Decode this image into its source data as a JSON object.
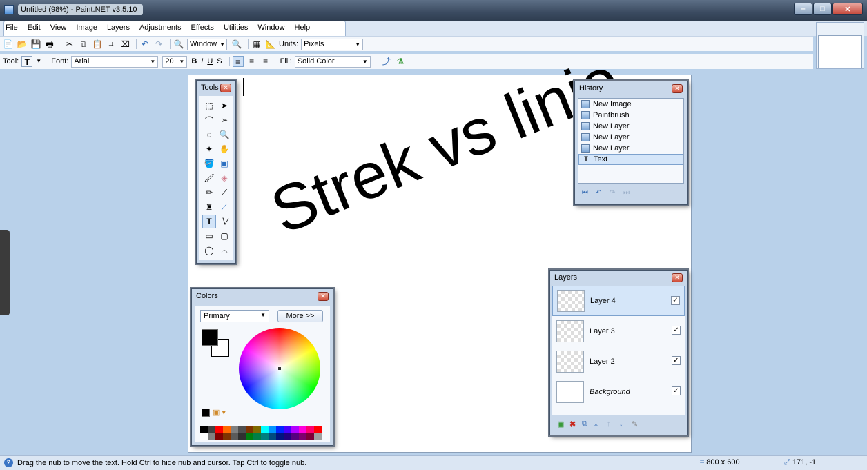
{
  "window": {
    "title": "Untitled (98%) - Paint.NET v3.5.10"
  },
  "menu": [
    "File",
    "Edit",
    "View",
    "Image",
    "Layers",
    "Adjustments",
    "Effects",
    "Utilities",
    "Window",
    "Help"
  ],
  "toolbar1": {
    "zoom_value": "Window",
    "units_label": "Units:",
    "units_value": "Pixels"
  },
  "toolbar2": {
    "tool_label": "Tool:",
    "font_label": "Font:",
    "font_value": "Arial",
    "size_value": "20",
    "bold": "B",
    "italic": "I",
    "underline": "U",
    "strike": "S",
    "fill_label": "Fill:",
    "fill_value": "Solid Color"
  },
  "canvas_text": "Strek vs linje",
  "panels": {
    "tools": {
      "title": "Tools"
    },
    "history": {
      "title": "History",
      "items": [
        "New Image",
        "Paintbrush",
        "New Layer",
        "New Layer",
        "New Layer",
        "Text"
      ],
      "selected_index": 5
    },
    "colors": {
      "title": "Colors",
      "mode": "Primary",
      "more": "More >>"
    },
    "layers": {
      "title": "Layers",
      "items": [
        {
          "name": "Layer 4",
          "visible": true,
          "selected": true
        },
        {
          "name": "Layer 3",
          "visible": true,
          "selected": false
        },
        {
          "name": "Layer 2",
          "visible": true,
          "selected": false
        },
        {
          "name": "Background",
          "visible": true,
          "selected": false
        }
      ]
    }
  },
  "statusbar": {
    "hint": "Drag the nub to move the text. Hold Ctrl to hide nub and cursor. Tap Ctrl to toggle nub.",
    "image_size": "800 x 600",
    "cursor_pos": "171, -1"
  },
  "colors_palette": [
    "#000000",
    "#404040",
    "#ff0000",
    "#ff6a00",
    "#808080",
    "#4f4f4f",
    "#7f3300",
    "#7f6a00",
    "#00ffff",
    "#0094ff",
    "#0026ff",
    "#4800ff",
    "#b200ff",
    "#ff00dc",
    "#ff006e",
    "#ff0000",
    "#ffffff",
    "#808080",
    "#7f0000",
    "#7f3300",
    "#5b5b5b",
    "#303030",
    "#007f0e",
    "#007f46",
    "#007f7f",
    "#004a7f",
    "#00137f",
    "#21007f",
    "#57007f",
    "#7f006e",
    "#7f0037",
    "#a0a0a0"
  ]
}
